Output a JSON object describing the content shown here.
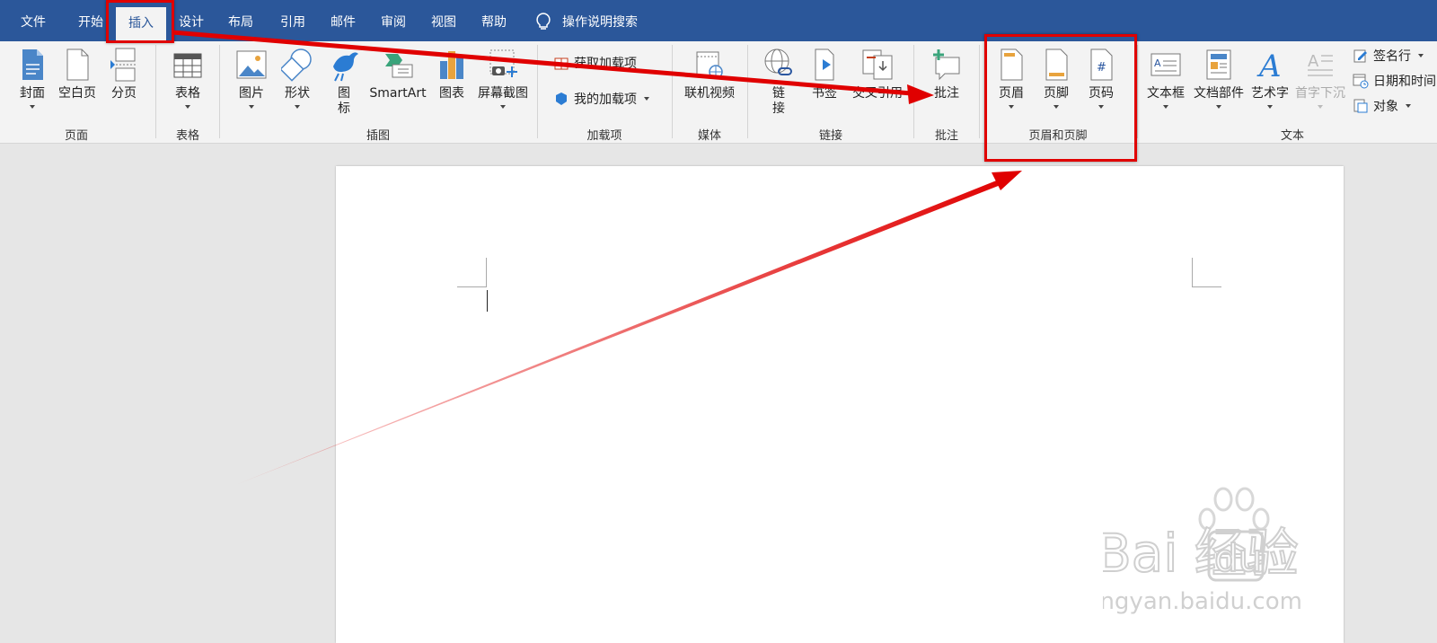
{
  "tabs": [
    "文件",
    "开始",
    "插入",
    "设计",
    "布局",
    "引用",
    "邮件",
    "审阅",
    "视图",
    "帮助"
  ],
  "active_tab": "插入",
  "tell_me": "操作说明搜索",
  "ribbon": {
    "pages": {
      "cover": "封面",
      "blank": "空白页",
      "break": "分页",
      "group": "页面"
    },
    "tables": {
      "table": "表格",
      "group": "表格"
    },
    "illustrations": {
      "pictures": "图片",
      "shapes": "形状",
      "icons_1": "图",
      "icons_2": "标",
      "smartart": "SmartArt",
      "chart": "图表",
      "screenshot": "屏幕截图",
      "group": "插图"
    },
    "addins": {
      "get": "获取加载项",
      "mine": "我的加载项",
      "group": "加载项"
    },
    "media": {
      "video": "联机视频",
      "group": "媒体"
    },
    "links": {
      "link_1": "链",
      "link_2": "接",
      "bookmark": "书签",
      "crossref": "交叉引用",
      "group": "链接"
    },
    "comments": {
      "comment": "批注",
      "group": "批注"
    },
    "header_footer": {
      "header": "页眉",
      "footer": "页脚",
      "page_number": "页码",
      "group": "页眉和页脚"
    },
    "text": {
      "textbox": "文本框",
      "quickparts": "文档部件",
      "wordart": "艺术字",
      "dropcap": "首字下沉",
      "signature": "签名行",
      "datetime": "日期和时间",
      "object": "对象",
      "group": "文本"
    }
  },
  "watermark": {
    "brand": "Bai  经验",
    "url": "jingyan.baidu.com"
  },
  "colors": {
    "ribbon_blue": "#2b579a",
    "highlight_red": "#e00000"
  }
}
